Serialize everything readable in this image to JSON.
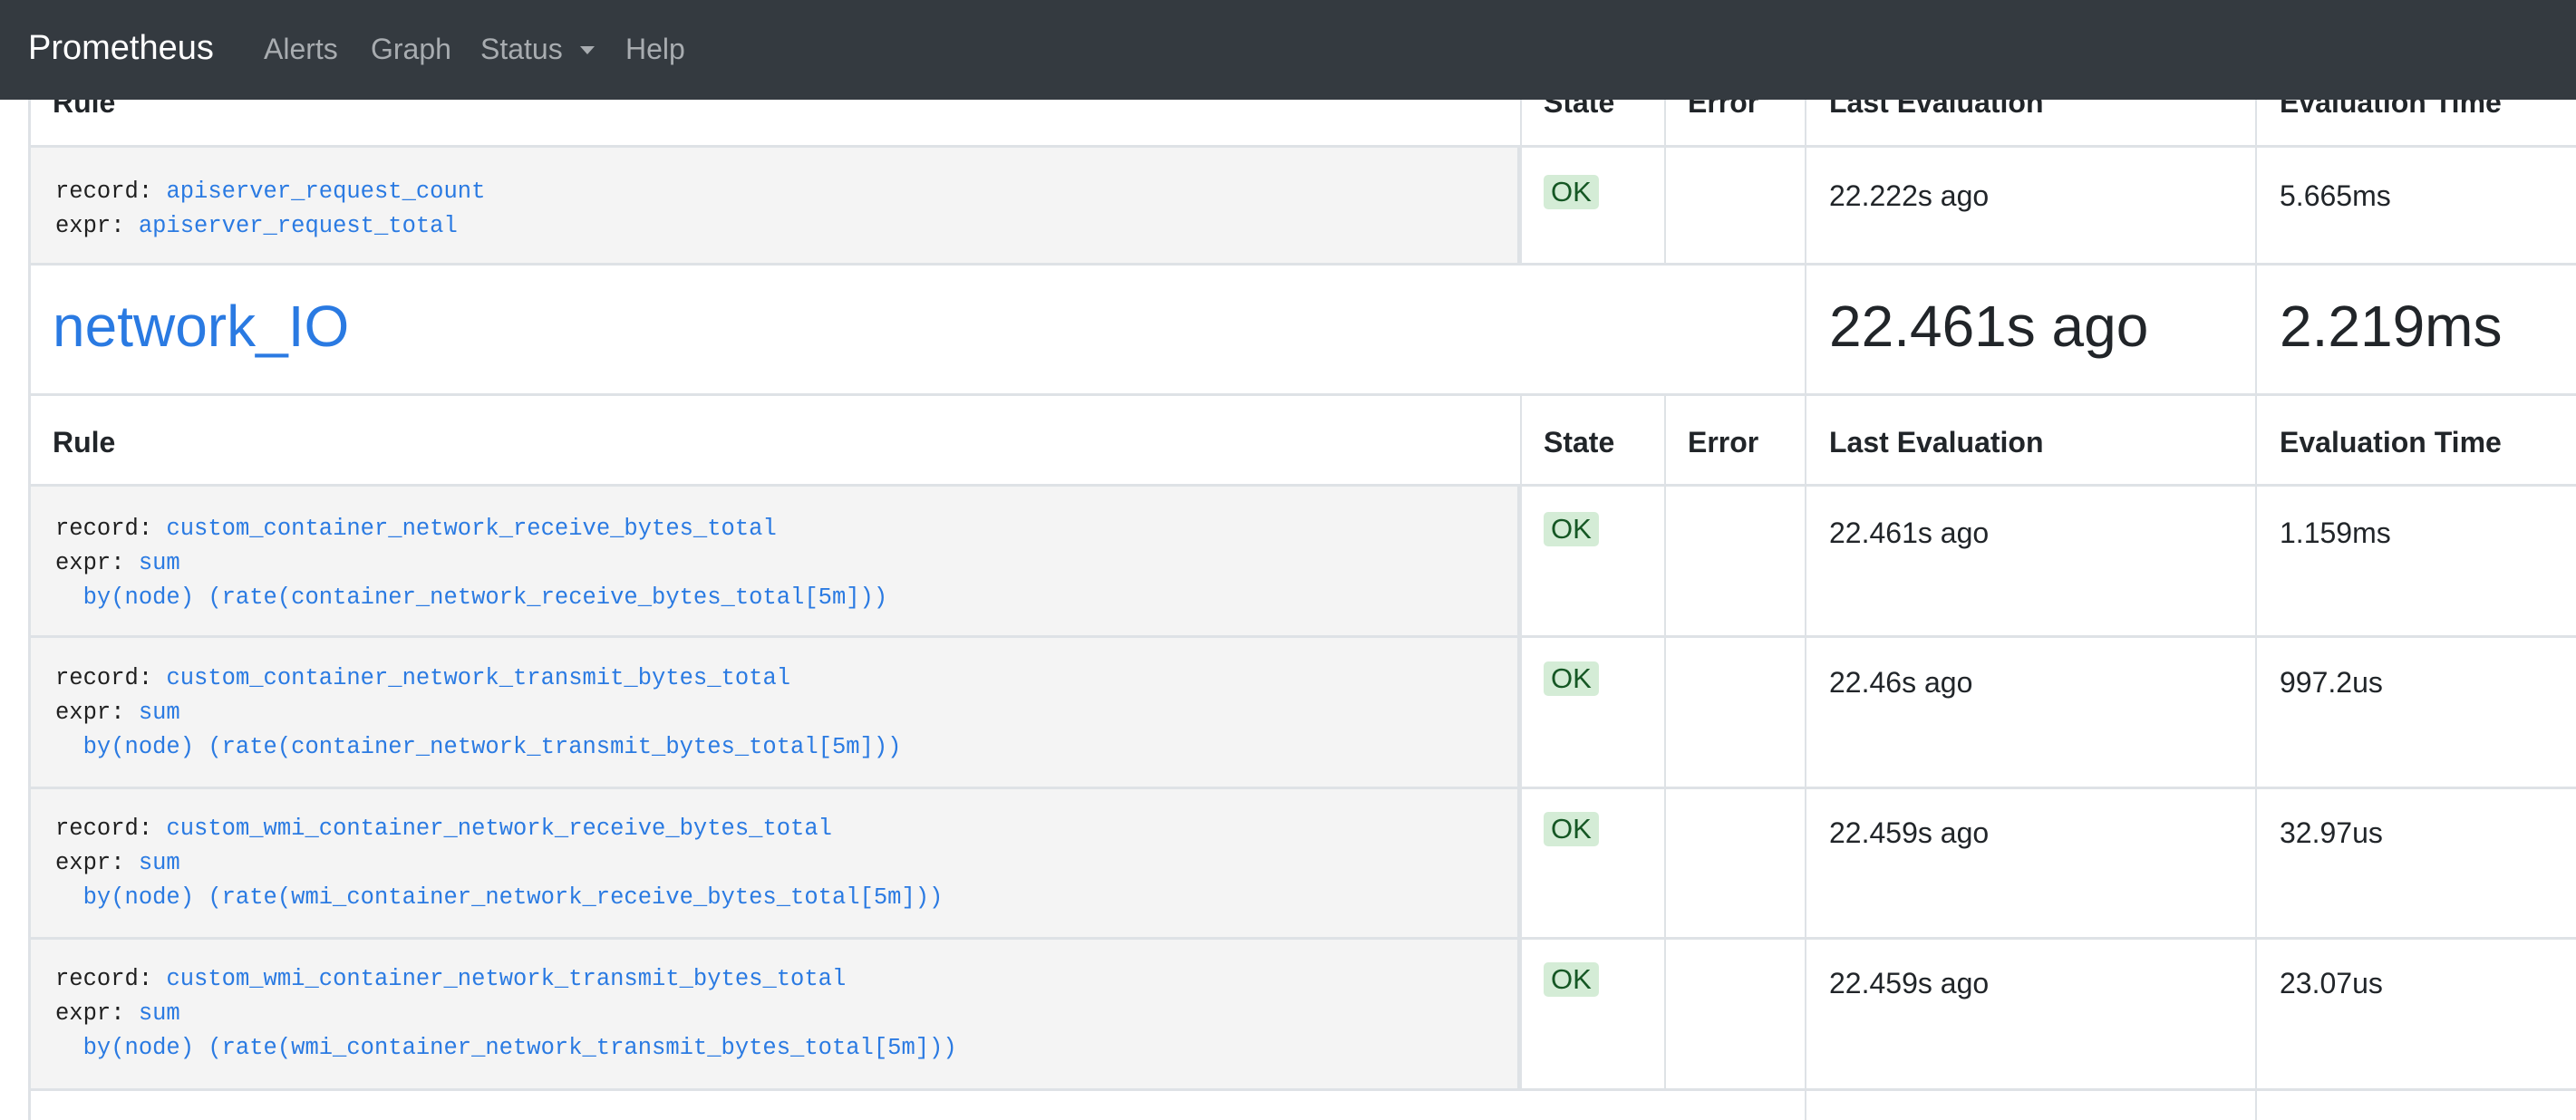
{
  "navbar": {
    "brand": "Prometheus",
    "links": [
      "Alerts",
      "Graph",
      "Status",
      "Help"
    ]
  },
  "table_headers": {
    "rule": "Rule",
    "state": "State",
    "error": "Error",
    "last_evaluation": "Last Evaluation",
    "evaluation_time": "Evaluation Time"
  },
  "rule_labels": {
    "record": "record:",
    "expr": "expr:"
  },
  "previous_group": {
    "rules": [
      {
        "record": "apiserver_request_count",
        "expr": "apiserver_request_total",
        "state": "OK",
        "error": "",
        "last_evaluation": "22.222s ago",
        "evaluation_time": "5.665ms"
      }
    ]
  },
  "group": {
    "name": "network_IO",
    "last_evaluation": "22.461s ago",
    "evaluation_time": "2.219ms",
    "rules": [
      {
        "record": "custom_container_network_receive_bytes_total",
        "expr_line1": "sum",
        "expr_line2": "by(node) (rate(container_network_receive_bytes_total[5m]))",
        "state": "OK",
        "error": "",
        "last_evaluation": "22.461s ago",
        "evaluation_time": "1.159ms"
      },
      {
        "record": "custom_container_network_transmit_bytes_total",
        "expr_line1": "sum",
        "expr_line2": "by(node) (rate(container_network_transmit_bytes_total[5m]))",
        "state": "OK",
        "error": "",
        "last_evaluation": "22.46s ago",
        "evaluation_time": "997.2us"
      },
      {
        "record": "custom_wmi_container_network_receive_bytes_total",
        "expr_line1": "sum",
        "expr_line2": "by(node) (rate(wmi_container_network_receive_bytes_total[5m]))",
        "state": "OK",
        "error": "",
        "last_evaluation": "22.459s ago",
        "evaluation_time": "32.97us"
      },
      {
        "record": "custom_wmi_container_network_transmit_bytes_total",
        "expr_line1": "sum",
        "expr_line2": "by(node) (rate(wmi_container_network_transmit_bytes_total[5m]))",
        "state": "OK",
        "error": "",
        "last_evaluation": "22.459s ago",
        "evaluation_time": "23.07us"
      }
    ]
  },
  "colors": {
    "navbar_bg": "#343a40",
    "link": "#2a7ae2",
    "ok_badge_bg": "#d4ecd6",
    "ok_badge_text": "#155724",
    "rule_cell_bg": "#f4f4f4"
  }
}
